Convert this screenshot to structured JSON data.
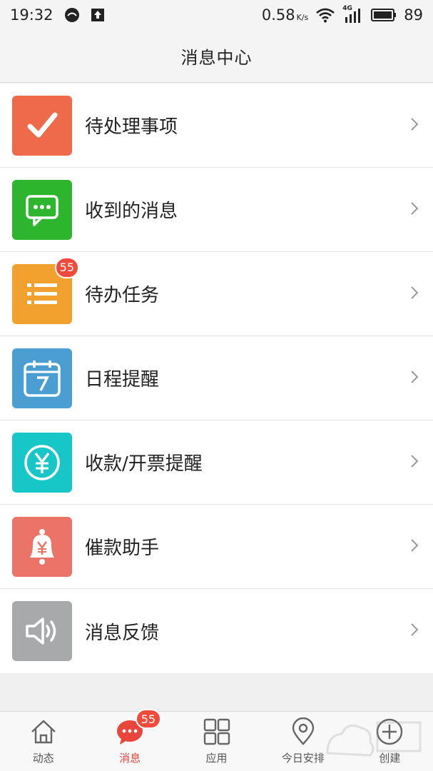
{
  "status_bar": {
    "time": "19:32",
    "speed_value": "0.58",
    "speed_unit": "K/s",
    "network": "4G",
    "battery": "89"
  },
  "header": {
    "title": "消息中心"
  },
  "items": [
    {
      "label": "待处理事项",
      "icon": "check-icon",
      "color": "#ef6a4a"
    },
    {
      "label": "收到的消息",
      "icon": "chat-bubble-icon",
      "color": "#2db52d"
    },
    {
      "label": "待办任务",
      "icon": "list-icon",
      "color": "#f2a02e",
      "badge": "55"
    },
    {
      "label": "日程提醒",
      "icon": "calendar-icon",
      "color": "#4a9ed1"
    },
    {
      "label": "收款/开票提醒",
      "icon": "yen-circle-icon",
      "color": "#17c7c7"
    },
    {
      "label": "催款助手",
      "icon": "bell-yen-icon",
      "color": "#ec7368"
    },
    {
      "label": "消息反馈",
      "icon": "speaker-icon",
      "color": "#a7a9ab"
    }
  ],
  "tabs": [
    {
      "label": "动态",
      "icon": "home-icon"
    },
    {
      "label": "消息",
      "icon": "message-icon",
      "badge": "55",
      "active": true
    },
    {
      "label": "应用",
      "icon": "grid-icon"
    },
    {
      "label": "今日安排",
      "icon": "location-pin-icon"
    },
    {
      "label": "创建",
      "icon": "plus-circle-icon"
    }
  ]
}
